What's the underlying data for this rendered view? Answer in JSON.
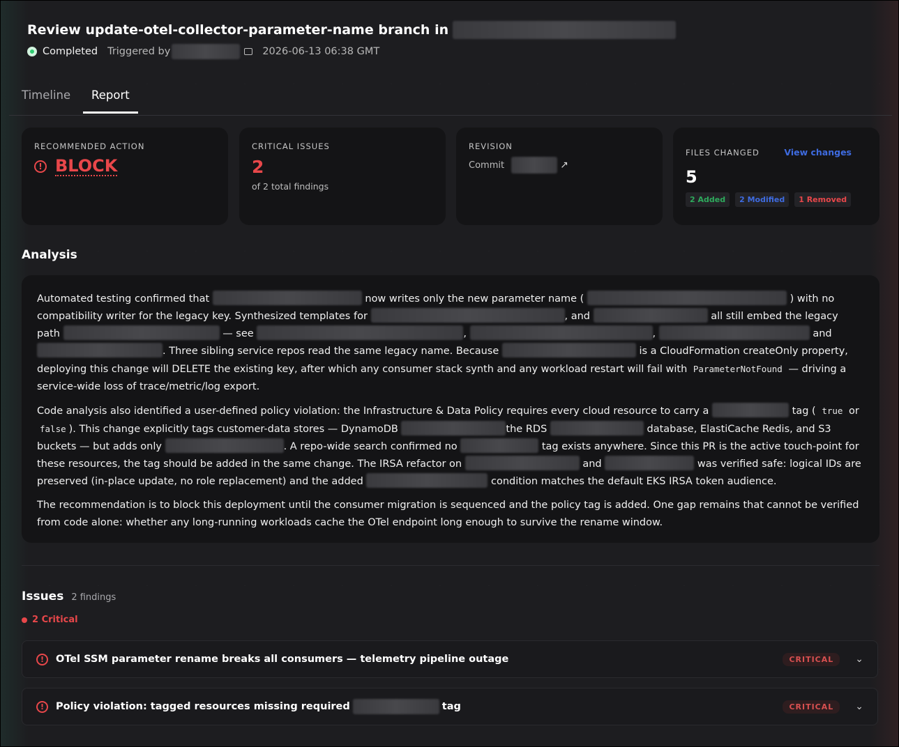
{
  "header": {
    "title_prefix": "Review update-otel-collector-parameter-name branch in",
    "status": "Completed",
    "triggered_by_label": "Triggered by",
    "timestamp": "2026-06-13 06:38 GMT"
  },
  "tabs": [
    {
      "label": "Timeline",
      "active": false
    },
    {
      "label": "Report",
      "active": true
    }
  ],
  "cards": {
    "recommended": {
      "label": "RECOMMENDED ACTION",
      "value": "BLOCK"
    },
    "critical": {
      "label": "CRITICAL ISSUES",
      "value": "2",
      "sub": "of 2 total findings"
    },
    "revision": {
      "label": "REVISION",
      "commit_label": "Commit"
    },
    "files": {
      "label": "FILES CHANGED",
      "link": "View changes",
      "value": "5",
      "added": "2 Added",
      "modified": "2 Modified",
      "removed": "1 Removed"
    }
  },
  "analysis": {
    "title": "Analysis",
    "p1": [
      "Automated testing confirmed that",
      "now writes only the new parameter name (",
      ") with no compatibility writer for the legacy key. Synthesized templates for",
      ", and",
      "all still embed the legacy path",
      "— see",
      ",",
      ",",
      "and",
      ". Three sibling service repos read the same legacy name. Because",
      "is a CloudFormation createOnly property, deploying this change will DELETE the existing key, after which any consumer stack synth and any workload restart will fail with",
      "ParameterNotFound",
      "— driving a service-wide loss of trace/metric/log export."
    ],
    "p2": [
      "Code analysis also identified a user-defined policy violation: the Infrastructure & Data Policy requires every cloud resource to carry a",
      "tag (",
      "true",
      "or",
      "false",
      "). This change explicitly tags customer-data stores — DynamoDB",
      "the RDS",
      "database, ElastiCache Redis, and S3 buckets — but adds only",
      ". A repo-wide search confirmed no",
      "tag exists anywhere. Since this PR is the active touch-point for these resources, the tag should be added in the same change. The IRSA refactor on",
      "and",
      "was verified safe: logical IDs are preserved (in-place update, no role replacement) and the added",
      "condition matches the default EKS IRSA token audience."
    ],
    "p3": "The recommendation is to block this deployment until the consumer migration is sequenced and the policy tag is added. One gap remains that cannot be verified from code alone: whether any long-running workloads cache the OTel endpoint long enough to survive the rename window."
  },
  "issues": {
    "title": "Issues",
    "count": "2 findings",
    "critical_summary": "2 Critical",
    "items": [
      {
        "title": "OTel SSM parameter rename breaks all consumers — telemetry pipeline outage",
        "severity": "CRITICAL"
      },
      {
        "title_prefix": "Policy violation: tagged resources missing required",
        "title_suffix": "tag",
        "severity": "CRITICAL"
      }
    ]
  },
  "colors": {
    "critical": "#e8474a",
    "link": "#3e6be0",
    "added": "#2eaa5c",
    "status_ok": "#2ecc71"
  }
}
